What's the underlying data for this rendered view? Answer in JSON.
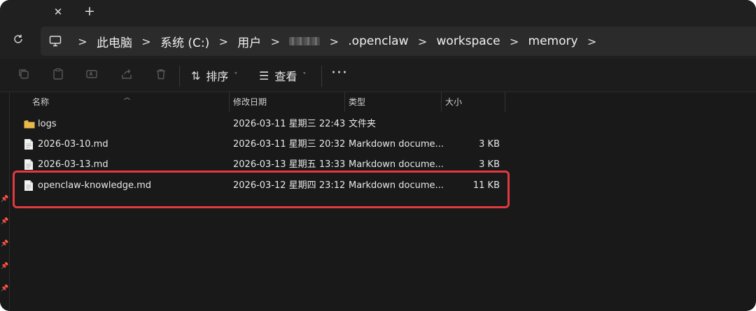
{
  "tabbar": {
    "close_glyph": "✕",
    "new_tab_glyph": "+"
  },
  "address": {
    "refresh_icon": "refresh-icon",
    "crumbs": [
      "此电脑",
      "系统 (C:)",
      "用户",
      ".openclaw",
      "workspace",
      "memory"
    ],
    "separator": ">"
  },
  "toolbar": {
    "sort_label": "排序",
    "view_label": "查看",
    "more_label": "···"
  },
  "columns": {
    "name": "名称",
    "modified": "修改日期",
    "type": "类型",
    "size": "大小"
  },
  "files": [
    {
      "name": "logs",
      "modified": "2026-03-11 星期三 22:43",
      "type": "文件夹",
      "size": "",
      "icon": "folder-icon"
    },
    {
      "name": "2026-03-10.md",
      "modified": "2026-03-11 星期三 20:32",
      "type": "Markdown docume...",
      "size": "3 KB",
      "icon": "file-icon"
    },
    {
      "name": "2026-03-13.md",
      "modified": "2026-03-13 星期五 13:33",
      "type": "Markdown docume...",
      "size": "3 KB",
      "icon": "file-icon"
    },
    {
      "name": "openclaw-knowledge.md",
      "modified": "2026-03-12 星期四 23:12",
      "type": "Markdown docume...",
      "size": "11 KB",
      "icon": "file-icon"
    }
  ],
  "colors": {
    "highlight": "#e0393e",
    "folder": "#e8b84a",
    "background": "#191919"
  }
}
